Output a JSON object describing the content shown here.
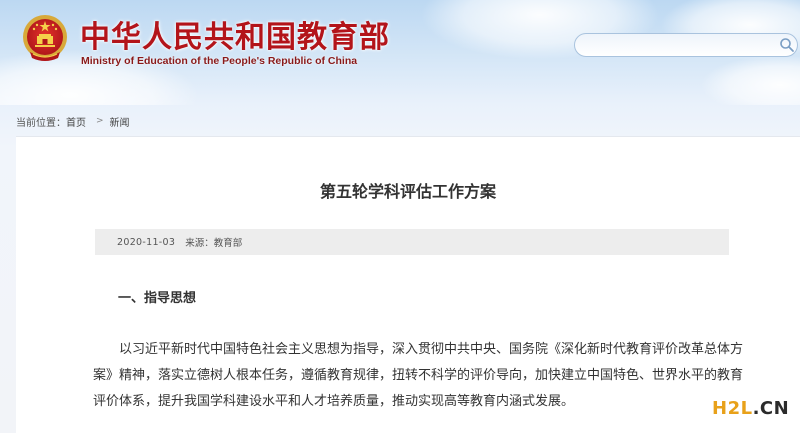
{
  "header": {
    "title": "中华人民共和国教育部",
    "subtitle": "Ministry of Education of the People's Republic of China"
  },
  "search": {
    "value": "",
    "placeholder": ""
  },
  "breadcrumb": {
    "prefix": "当前位置：",
    "home": "首页",
    "separator": ">",
    "current": "新闻"
  },
  "article": {
    "title": "第五轮学科评估工作方案",
    "date": "2020-11-03",
    "source": "来源：教育部",
    "section_heading": "一、指导思想",
    "paragraph": "以习近平新时代中国特色社会主义思想为指导，深入贯彻中共中央、国务院《深化新时代教育评价改革总体方案》精神，落实立德树人根本任务，遵循教育规律，扭转不科学的评价导向，加快建立中国特色、世界水平的教育评价体系，提升我国学科建设水平和人才培养质量，推动实现高等教育内涵式发展。"
  },
  "watermark": {
    "brand": "H2L",
    "suffix": ".CN"
  },
  "colors": {
    "title_red": "#b3141a",
    "sky_top": "#bcd8f2",
    "meta_bar": "#ededed",
    "watermark_orange": "#e8a11a"
  },
  "icons": [
    "national-emblem",
    "search-icon",
    "chevron-right-icon"
  ]
}
